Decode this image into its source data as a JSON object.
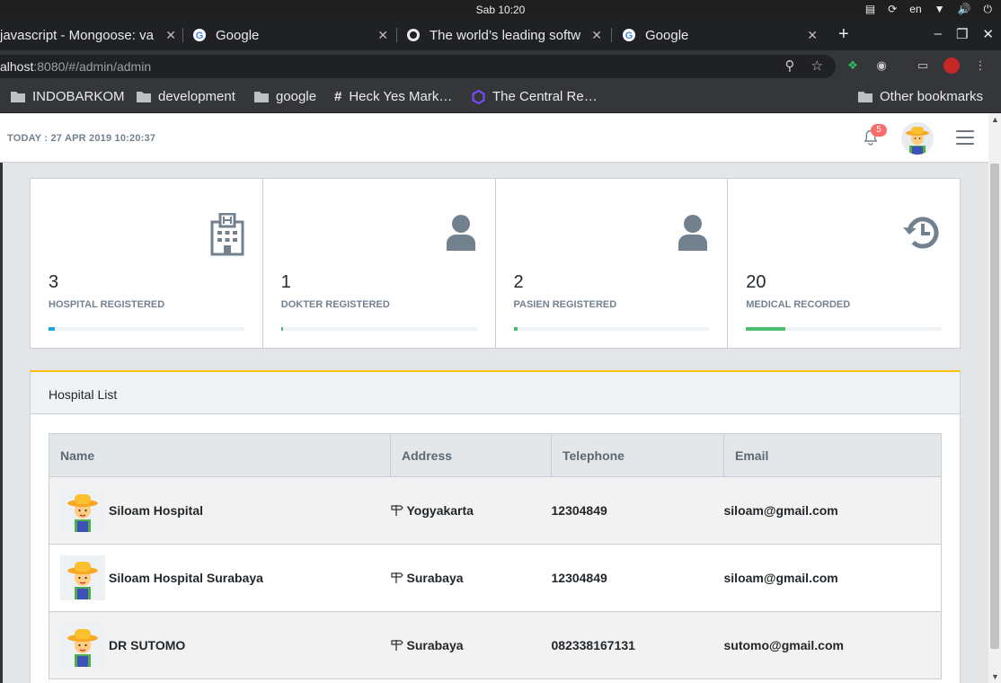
{
  "os": {
    "clock": "Sab 10:20",
    "lang": "en"
  },
  "tabs": [
    {
      "title": "javascript - Mongoose: va",
      "favicon": "stackoverflow-icon"
    },
    {
      "title": "Google",
      "favicon": "google-icon"
    },
    {
      "title": "The world’s leading softw",
      "favicon": "github-icon"
    },
    {
      "title": "Google",
      "favicon": "google-icon"
    }
  ],
  "address": {
    "host": "alhost",
    "path": ":8080/#/admin/admin"
  },
  "bookmarks": [
    {
      "label": "INDOBARKOM",
      "icon": "folder-icon"
    },
    {
      "label": "development",
      "icon": "folder-icon"
    },
    {
      "label": "google",
      "icon": "folder-icon"
    },
    {
      "label": "Heck Yes Mark…",
      "icon": "hash-icon"
    },
    {
      "label": "The Central Re…",
      "icon": "hexagon-icon"
    }
  ],
  "other_bookmarks": "Other bookmarks",
  "header": {
    "today": "TODAY : 27 APR 2019 10:20:37",
    "notifications": "5"
  },
  "stats": [
    {
      "value": "3",
      "label": "HOSPITAL REGISTERED",
      "icon": "hospital-icon",
      "progress": 0.03,
      "color": "#20a8d8"
    },
    {
      "value": "1",
      "label": "DOKTER REGISTERED",
      "icon": "user-icon",
      "progress": 0.01,
      "color": "#4dbd74"
    },
    {
      "value": "2",
      "label": "PASIEN REGISTERED",
      "icon": "user-icon",
      "progress": 0.02,
      "color": "#4dbd74"
    },
    {
      "value": "20",
      "label": "MEDICAL RECORDED",
      "icon": "history-icon",
      "progress": 0.2,
      "color": "#4dbd74"
    }
  ],
  "hospital_list": {
    "title": "Hospital List",
    "columns": [
      "Name",
      "Address",
      "Telephone",
      "Email"
    ],
    "rows": [
      {
        "name": "Siloam Hospital",
        "address": "Yogyakarta",
        "telephone": "12304849",
        "email": "siloam@gmail.com"
      },
      {
        "name": "Siloam Hospital Surabaya",
        "address": "Surabaya",
        "telephone": "12304849",
        "email": "siloam@gmail.com"
      },
      {
        "name": "DR SUTOMO",
        "address": "Surabaya",
        "telephone": "082338167131",
        "email": "sutomo@gmail.com"
      }
    ]
  }
}
